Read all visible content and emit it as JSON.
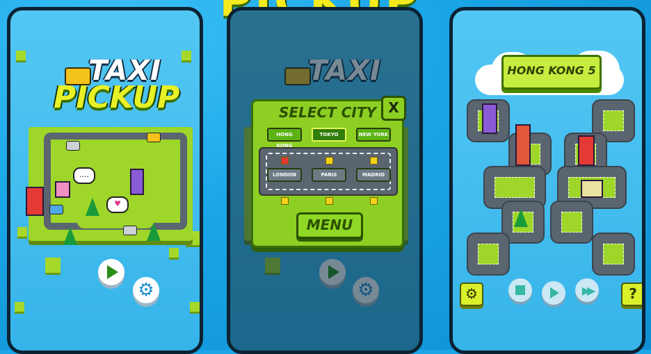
{
  "banner": {
    "text": "PICKUP"
  },
  "screen1": {
    "logo_top": "TAXI",
    "logo_bottom": "PICKUP",
    "bubble_text": "....",
    "play_icon": "play-icon",
    "settings_icon": "gear-icon"
  },
  "screen2": {
    "dialog_title": "SELECT CITY",
    "close_label": "X",
    "cities_top": [
      "HONG KONG",
      "TOKYO",
      "NEW YORK"
    ],
    "cities_bottom": [
      "LONDON",
      "PARIS",
      "MADRID"
    ],
    "selected_city": "TOKYO",
    "menu_label": "MENU"
  },
  "screen3": {
    "level_title": "HONG KONG 5",
    "help_label": "?",
    "settings_icon": "gear-icon",
    "stop_icon": "stop-icon",
    "play_icon": "play-icon",
    "fast_forward_icon": "fast-forward-icon"
  },
  "colors": {
    "sky": "#1aa6e8",
    "grass": "#9ed629",
    "road": "#5b6570",
    "logo_yellow": "#e8f126"
  }
}
